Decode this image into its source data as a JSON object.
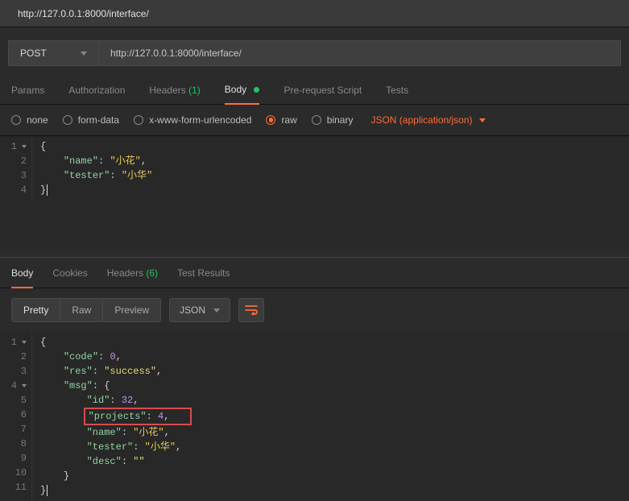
{
  "tab_title": "http://127.0.0.1:8000/interface/",
  "method": "POST",
  "url": "http://127.0.0.1:8000/interface/",
  "request_tabs": {
    "params": "Params",
    "auth": "Authorization",
    "headers_label": "Headers",
    "headers_count": "(1)",
    "body": "Body",
    "prerequest": "Pre-request Script",
    "tests": "Tests"
  },
  "body_types": {
    "none": "none",
    "form_data": "form-data",
    "urlencoded": "x-www-form-urlencoded",
    "raw": "raw",
    "binary": "binary",
    "content_type": "JSON (application/json)"
  },
  "request_code": {
    "lines": [
      "1",
      "2",
      "3",
      "4"
    ],
    "open_brace": "{",
    "name_key": "\"name\"",
    "name_val": "\"小花\"",
    "tester_key": "\"tester\"",
    "tester_val": "\"小华\"",
    "close_brace": "}"
  },
  "response_tabs": {
    "body": "Body",
    "cookies": "Cookies",
    "headers_label": "Headers",
    "headers_count": "(6)",
    "test_results": "Test Results"
  },
  "view": {
    "pretty": "Pretty",
    "raw": "Raw",
    "preview": "Preview",
    "json_dd": "JSON"
  },
  "response_code": {
    "lines": [
      "1",
      "2",
      "3",
      "4",
      "5",
      "6",
      "7",
      "8",
      "9",
      "10",
      "11"
    ],
    "open_brace": "{",
    "code_key": "\"code\"",
    "code_val": "0",
    "res_key": "\"res\"",
    "res_val": "\"success\"",
    "msg_key": "\"msg\"",
    "id_key": "\"id\"",
    "id_val": "32",
    "projects_key": "\"projects\"",
    "projects_val": "4",
    "name_key": "\"name\"",
    "name_val": "\"小花\"",
    "tester_key": "\"tester\"",
    "tester_val": "\"小华\"",
    "desc_key": "\"desc\"",
    "desc_val": "\"\"",
    "close_brace_inner": "}",
    "close_brace": "}"
  }
}
